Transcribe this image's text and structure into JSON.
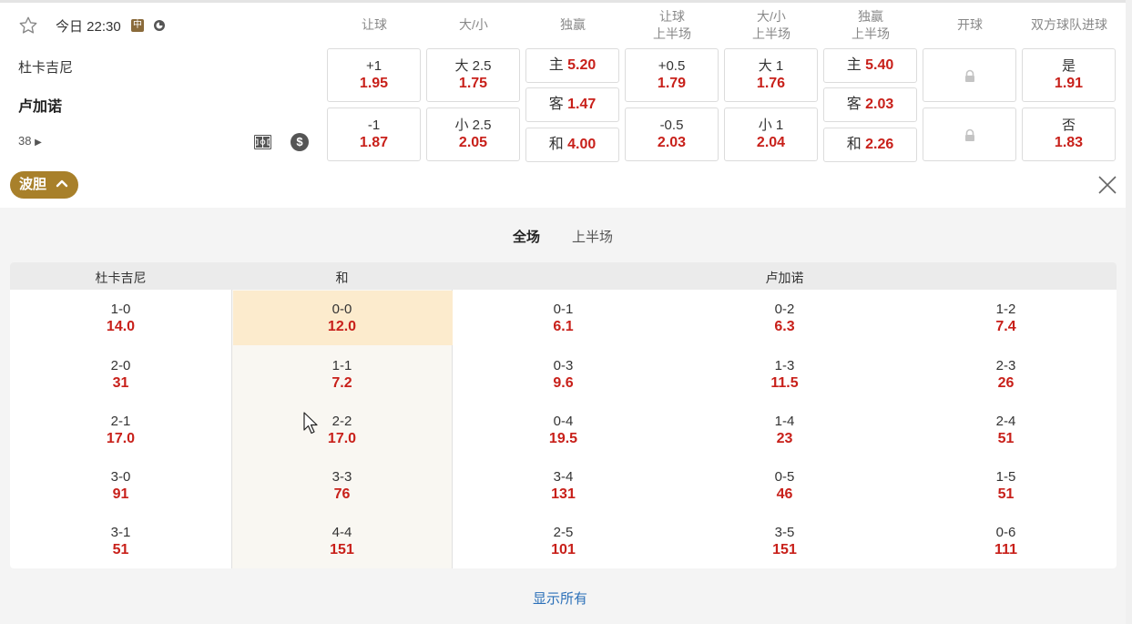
{
  "match": {
    "kickoff": "今日 22:30",
    "badge": "中",
    "home": "杜卡吉尼",
    "away": "卢加诺",
    "more_markets": "38"
  },
  "columns": [
    "让球",
    "大/小",
    "独赢",
    "让球\n上半场",
    "大/小\n上半场",
    "独赢\n上半场",
    "开球",
    "双方球队进球"
  ],
  "odds": {
    "handicap": [
      {
        "line": "+1",
        "odd": "1.95"
      },
      {
        "line": "-1",
        "odd": "1.87"
      }
    ],
    "total": [
      {
        "line": "大 2.5",
        "odd": "1.75"
      },
      {
        "line": "小 2.5",
        "odd": "2.05"
      }
    ],
    "moneyline": [
      {
        "line": "主",
        "odd": "5.20"
      },
      {
        "line": "客",
        "odd": "1.47"
      },
      {
        "line": "和",
        "odd": "4.00"
      }
    ],
    "handicap_1h": [
      {
        "line": "+0.5",
        "odd": "1.79"
      },
      {
        "line": "-0.5",
        "odd": "2.03"
      }
    ],
    "total_1h": [
      {
        "line": "大 1",
        "odd": "1.76"
      },
      {
        "line": "小 1",
        "odd": "2.04"
      }
    ],
    "moneyline_1h": [
      {
        "line": "主",
        "odd": "5.40"
      },
      {
        "line": "客",
        "odd": "2.03"
      },
      {
        "line": "和",
        "odd": "2.26"
      }
    ],
    "btts": [
      {
        "line": "是",
        "odd": "1.91"
      },
      {
        "line": "否",
        "odd": "1.83"
      }
    ]
  },
  "correct_score": {
    "toggle_label": "波胆",
    "tabs": [
      "全场",
      "上半场"
    ],
    "headers": {
      "home": "杜卡吉尼",
      "draw": "和",
      "away": "卢加诺"
    },
    "rows": [
      [
        {
          "s": "1-0",
          "o": "14.0"
        },
        {
          "s": "0-0",
          "o": "12.0"
        },
        {
          "s": "0-1",
          "o": "6.1"
        },
        {
          "s": "0-2",
          "o": "6.3"
        },
        {
          "s": "1-2",
          "o": "7.4"
        }
      ],
      [
        {
          "s": "2-0",
          "o": "31"
        },
        {
          "s": "1-1",
          "o": "7.2"
        },
        {
          "s": "0-3",
          "o": "9.6"
        },
        {
          "s": "1-3",
          "o": "11.5"
        },
        {
          "s": "2-3",
          "o": "26"
        }
      ],
      [
        {
          "s": "2-1",
          "o": "17.0"
        },
        {
          "s": "2-2",
          "o": "17.0"
        },
        {
          "s": "0-4",
          "o": "19.5"
        },
        {
          "s": "1-4",
          "o": "23"
        },
        {
          "s": "2-4",
          "o": "51"
        }
      ],
      [
        {
          "s": "3-0",
          "o": "91"
        },
        {
          "s": "3-3",
          "o": "76"
        },
        {
          "s": "3-4",
          "o": "131"
        },
        {
          "s": "0-5",
          "o": "46"
        },
        {
          "s": "1-5",
          "o": "51"
        }
      ],
      [
        {
          "s": "3-1",
          "o": "51"
        },
        {
          "s": "4-4",
          "o": "151"
        },
        {
          "s": "2-5",
          "o": "101"
        },
        {
          "s": "3-5",
          "o": "151"
        },
        {
          "s": "0-6",
          "o": "111"
        }
      ]
    ],
    "show_all": "显示所有"
  },
  "colors": {
    "accent": "#a8802a",
    "odd": "#c8201a",
    "link": "#2a6fb8",
    "highlight": "#fcebcd"
  }
}
